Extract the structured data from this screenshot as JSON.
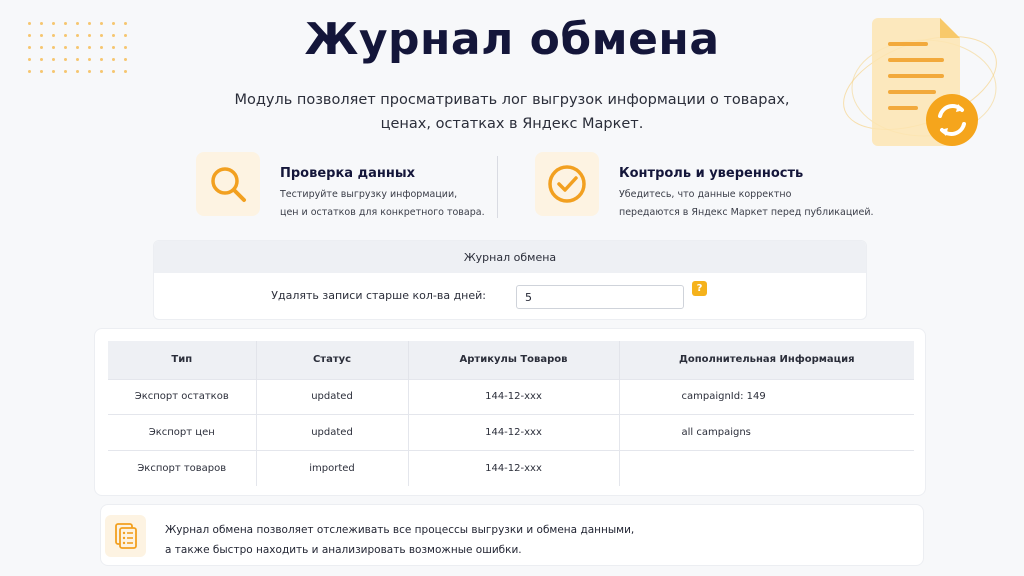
{
  "page": {
    "title": "Журнал обмена",
    "subtitle_line1": "Модуль позволяет просматривать лог выгрузок информации о товарах,",
    "subtitle_line2": "ценах, остатках в Яндекс Маркет."
  },
  "features": [
    {
      "icon": "search-icon",
      "title": "Проверка данных",
      "desc_line1": "Тестируйте выгрузку информации,",
      "desc_line2": "цен и остатков для конкретного товара."
    },
    {
      "icon": "check-circle-icon",
      "title": "Контроль и уверенность",
      "desc_line1": "Убедитесь, что данные корректно",
      "desc_line2": "передаются в Яндекс Маркет перед публикацией."
    }
  ],
  "settings": {
    "header": "Журнал обмена",
    "field_label": "Удалять записи старше кол-ва дней:",
    "field_value": "5",
    "help_label": "?"
  },
  "table": {
    "columns": [
      "Тип",
      "Статус",
      "Артикулы Товаров",
      "Дополнительная Информация"
    ],
    "rows": [
      [
        "Экспорт остатков",
        "updated",
        "144-12-xxx",
        "campaignId: 149"
      ],
      [
        "Экспорт цен",
        "updated",
        "144-12-xxx",
        "all campaigns"
      ],
      [
        "Экспорт товаров",
        "imported",
        "144-12-xxx",
        ""
      ]
    ]
  },
  "note": {
    "icon": "document-list-icon",
    "line1": "Журнал обмена позволяет отслеживать все процессы выгрузки и обмена данными,",
    "line2": "а также быстро находить и анализировать возможные ошибки."
  },
  "colors": {
    "accent": "#f5b21b",
    "title": "#14163a",
    "icon_bg": "#fdf3e2"
  }
}
